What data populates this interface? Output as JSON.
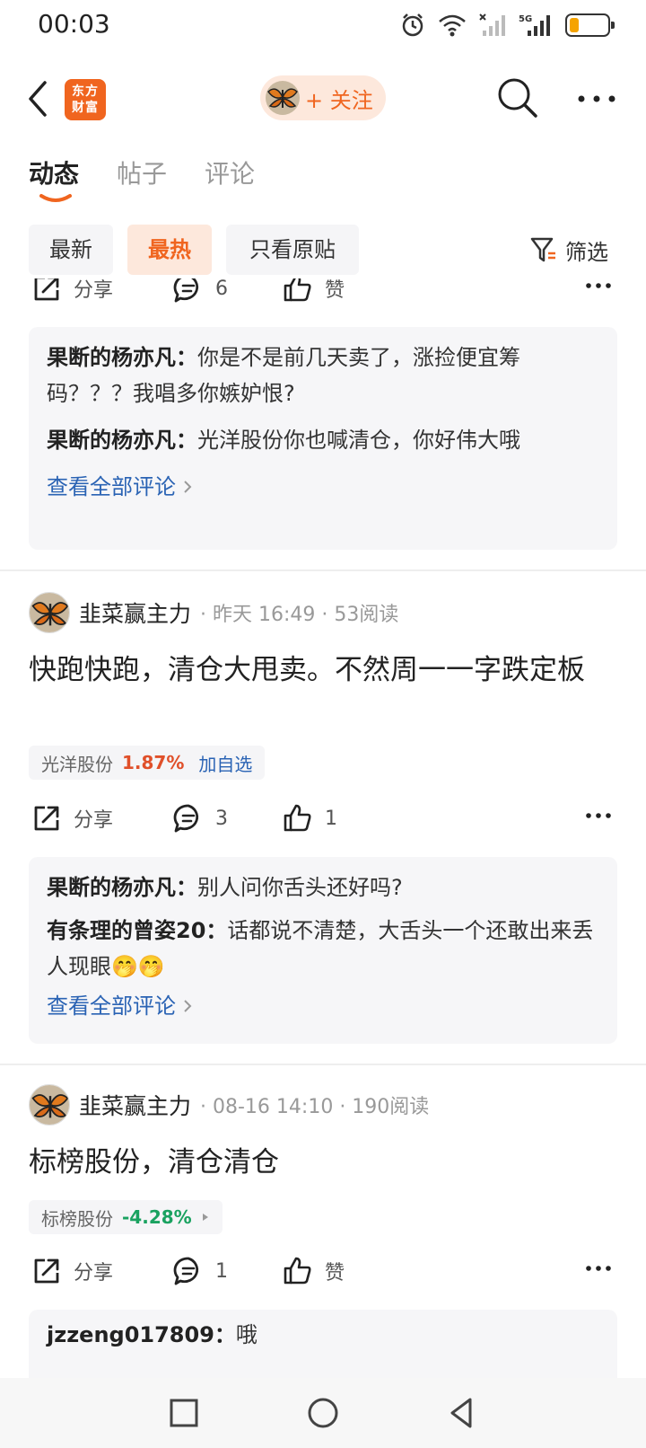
{
  "status_bar": {
    "time": "00:03",
    "battery_level": 0.25,
    "battery_color": "#f5a300"
  },
  "header": {
    "logo_line1": "东方",
    "logo_line2": "财富",
    "follow_label": "+ 关注",
    "accent_color": "#f0651f"
  },
  "tabs": [
    {
      "label": "动态",
      "active": true
    },
    {
      "label": "帖子",
      "active": false
    },
    {
      "label": "评论",
      "active": false
    }
  ],
  "filters": {
    "chips": [
      {
        "label": "最新",
        "active": false
      },
      {
        "label": "最热",
        "active": true
      },
      {
        "label": "只看原贴",
        "active": false
      }
    ],
    "filter_label": "筛选"
  },
  "post0": {
    "share_label": "分享",
    "comment_count": "6",
    "like_label": "赞",
    "comments": [
      {
        "name": "果断的杨亦凡：",
        "text": "你是不是前几天卖了，涨捡便宜筹码？？？我唱多你嫉妒恨?"
      },
      {
        "name": "果断的杨亦凡：",
        "text": "光洋股份你也喊清仓，你好伟大哦"
      }
    ],
    "view_all": "查看全部评论"
  },
  "post1": {
    "author": "韭菜赢主力",
    "meta": "· 昨天 16:49 · 53阅读",
    "text": "快跑快跑，清仓大甩卖。不然周一一字跌定板",
    "stock_name": "光洋股份",
    "stock_change": "1.87%",
    "add_watch": "加自选",
    "share_label": "分享",
    "comment_count": "3",
    "like_count": "1",
    "comments": [
      {
        "name": "果断的杨亦凡：",
        "text": "别人问你舌头还好吗?"
      },
      {
        "name": "有条理的曾姿20：",
        "text": "话都说不清楚，大舌头一个还敢出来丢人现眼🤭🤭"
      }
    ],
    "view_all": "查看全部评论"
  },
  "post2": {
    "author": "韭菜赢主力",
    "meta": "· 08-16 14:10 · 190阅读",
    "text": "标榜股份，清仓清仓",
    "stock_name": "标榜股份",
    "stock_change": "-4.28%",
    "share_label": "分享",
    "comment_count": "1",
    "like_label": "赞",
    "partial_comment_name": "jzzeng017809：",
    "partial_comment_text": "哦"
  }
}
